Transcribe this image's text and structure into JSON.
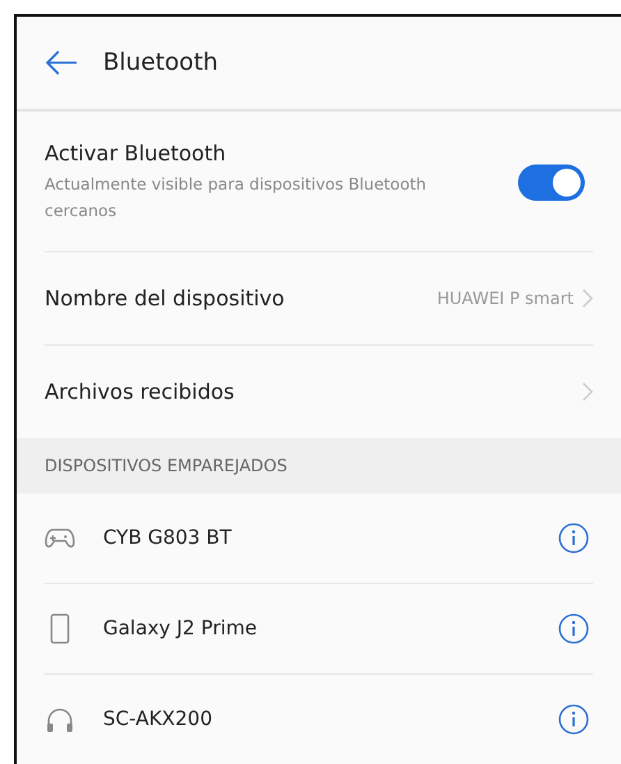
{
  "header": {
    "title": "Bluetooth"
  },
  "bluetooth_toggle": {
    "label": "Activar Bluetooth",
    "description": "Actualmente visible para dispositivos Bluetooth cercanos",
    "on": true
  },
  "settings": [
    {
      "label": "Nombre del dispositivo",
      "value": "HUAWEI P smart"
    },
    {
      "label": "Archivos recibidos"
    }
  ],
  "paired_section": {
    "title": "DISPOSITIVOS EMPAREJADOS"
  },
  "paired_devices": [
    {
      "name": "CYB G803 BT",
      "kind": "gamepad"
    },
    {
      "name": "Galaxy J2 Prime",
      "kind": "phone"
    },
    {
      "name": "SC-AKX200",
      "kind": "headphones"
    }
  ]
}
